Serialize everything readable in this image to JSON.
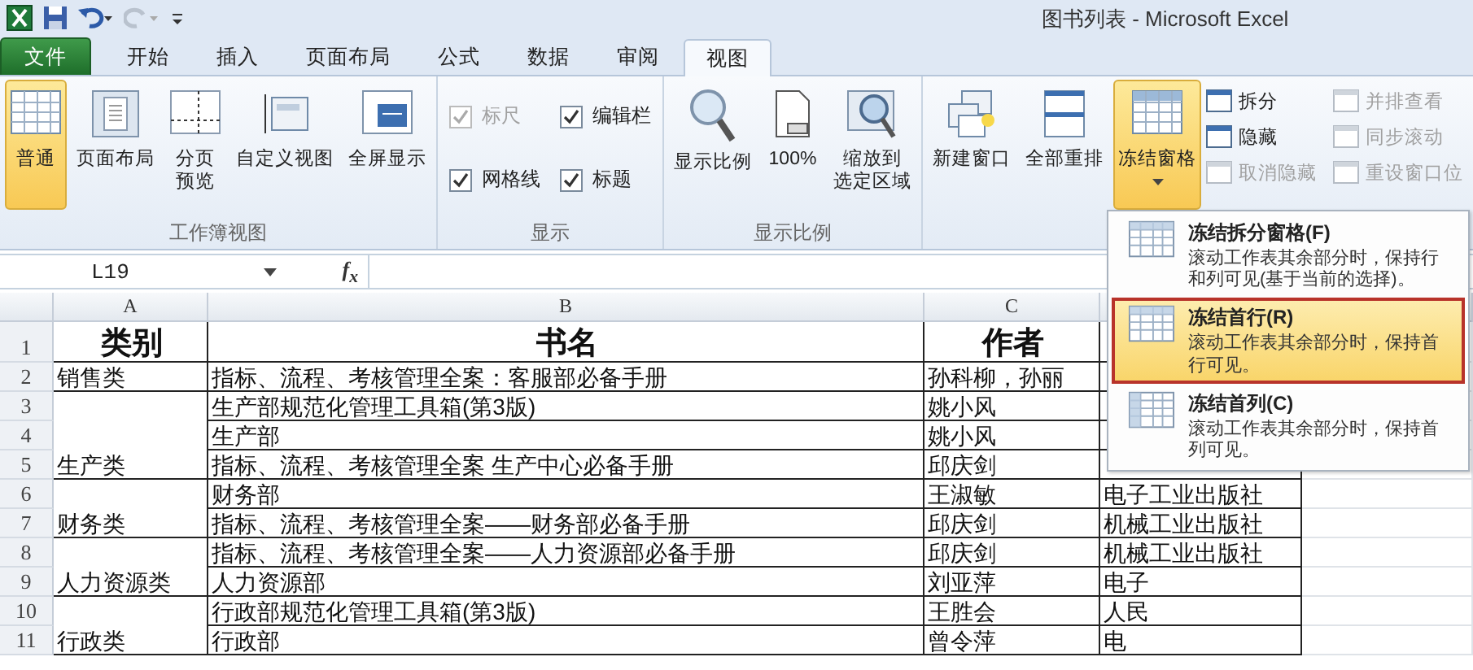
{
  "window": {
    "title": "图书列表 - Microsoft Excel"
  },
  "tabs": [
    {
      "label": "文件",
      "kind": "file",
      "selected": false
    },
    {
      "label": "开始",
      "kind": "tab",
      "selected": false
    },
    {
      "label": "插入",
      "kind": "tab",
      "selected": false
    },
    {
      "label": "页面布局",
      "kind": "tab",
      "selected": false
    },
    {
      "label": "公式",
      "kind": "tab",
      "selected": false
    },
    {
      "label": "数据",
      "kind": "tab",
      "selected": false
    },
    {
      "label": "审阅",
      "kind": "tab",
      "selected": false
    },
    {
      "label": "视图",
      "kind": "tab",
      "selected": true
    }
  ],
  "ribbon_groups": [
    {
      "label": "工作簿视图",
      "items": [
        {
          "kind": "large",
          "label": "普通",
          "selected": true
        },
        {
          "kind": "large",
          "label": "页面布局",
          "selected": false
        },
        {
          "kind": "large",
          "label_lines": [
            "分页",
            "预览"
          ],
          "selected": false
        },
        {
          "kind": "large",
          "label": "自定义视图",
          "selected": false
        },
        {
          "kind": "large",
          "label": "全屏显示",
          "selected": false
        }
      ]
    },
    {
      "label": "显示",
      "items": [
        {
          "kind": "check",
          "label": "标尺",
          "checked": true,
          "disabled": true
        },
        {
          "kind": "check",
          "label": "编辑栏",
          "checked": true,
          "disabled": false
        },
        {
          "kind": "check",
          "label": "网格线",
          "checked": true,
          "disabled": false
        },
        {
          "kind": "check",
          "label": "标题",
          "checked": true,
          "disabled": false
        }
      ]
    },
    {
      "label": "显示比例",
      "items": [
        {
          "kind": "large",
          "label": "显示比例",
          "selected": false
        },
        {
          "kind": "large",
          "label": "100%",
          "selected": false
        },
        {
          "kind": "large",
          "label_lines": [
            "缩放到",
            "选定区域"
          ],
          "selected": false
        }
      ]
    },
    {
      "items": [
        {
          "kind": "large",
          "label": "新建窗口",
          "selected": false
        },
        {
          "kind": "large",
          "label": "全部重排",
          "selected": false
        },
        {
          "kind": "large",
          "label": "冻结窗格",
          "selected": true,
          "dropdown": true
        },
        {
          "kind": "small",
          "label": "拆分",
          "disabled": false
        },
        {
          "kind": "small",
          "label": "隐藏",
          "disabled": false
        },
        {
          "kind": "small",
          "label": "取消隐藏",
          "disabled": true
        },
        {
          "kind": "small",
          "label": "并排查看",
          "disabled": true
        },
        {
          "kind": "small",
          "label": "同步滚动",
          "disabled": true
        },
        {
          "kind": "small",
          "label": "重设窗口位",
          "disabled": true
        }
      ]
    }
  ],
  "formula_bar": {
    "name_box": "L19",
    "function_label": "f$_{x}$"
  },
  "sheet": {
    "columns": [
      "A",
      "B",
      "C"
    ],
    "header": {
      "number": "1",
      "category": "类别",
      "book": "书名",
      "author": "作者"
    },
    "groups": [
      {
        "category": "销售类",
        "rows": [
          {
            "number": "2",
            "book": "指标、流程、考核管理全案：客服部必备手册",
            "author": "孙科柳，孙丽"
          }
        ]
      },
      {
        "category": "生产类",
        "rows": [
          {
            "number": "3",
            "book": "生产部规范化管理工具箱(第3版)",
            "author": "姚小风"
          },
          {
            "number": "4",
            "book": "生产部",
            "author": "姚小风"
          },
          {
            "number": "5",
            "book": "指标、流程、考核管理全案 生产中心必备手册",
            "author": "邱庆剑"
          }
        ]
      },
      {
        "category": "财务类",
        "rows": [
          {
            "number": "6",
            "book": "财务部",
            "author": "王淑敏",
            "publisher": "电子工业出版社"
          },
          {
            "number": "7",
            "book": "指标、流程、考核管理全案——财务部必备手册",
            "author": "邱庆剑",
            "publisher": "机械工业出版社"
          }
        ]
      },
      {
        "category": "人力资源类",
        "rows": [
          {
            "number": "8",
            "book": "指标、流程、考核管理全案——人力资源部必备手册",
            "author": "邱庆剑",
            "publisher": "机械工业出版社"
          },
          {
            "number": "9",
            "book": "人力资源部",
            "author": "刘亚萍",
            "publisher": "电子"
          }
        ]
      },
      {
        "category": "行政类",
        "rows": [
          {
            "number": "10",
            "book": "行政部规范化管理工具箱(第3版)",
            "author": "王胜会",
            "publisher": "人民"
          },
          {
            "number": "11",
            "book": "行政部",
            "author": "曾令萍",
            "publisher": "电"
          }
        ]
      }
    ]
  },
  "freeze_menu": [
    {
      "title": "冻结拆分窗格(F)",
      "description": "滚动工作表其余部分时，保持行和列可见(基于当前的选择)。",
      "selected": false
    },
    {
      "title": "冻结首行(R)",
      "description": "滚动工作表其余部分时，保持首行可见。",
      "selected": true
    },
    {
      "title": "冻结首列(C)",
      "description": "滚动工作表其余部分时，保持首列可见。",
      "selected": false
    }
  ]
}
